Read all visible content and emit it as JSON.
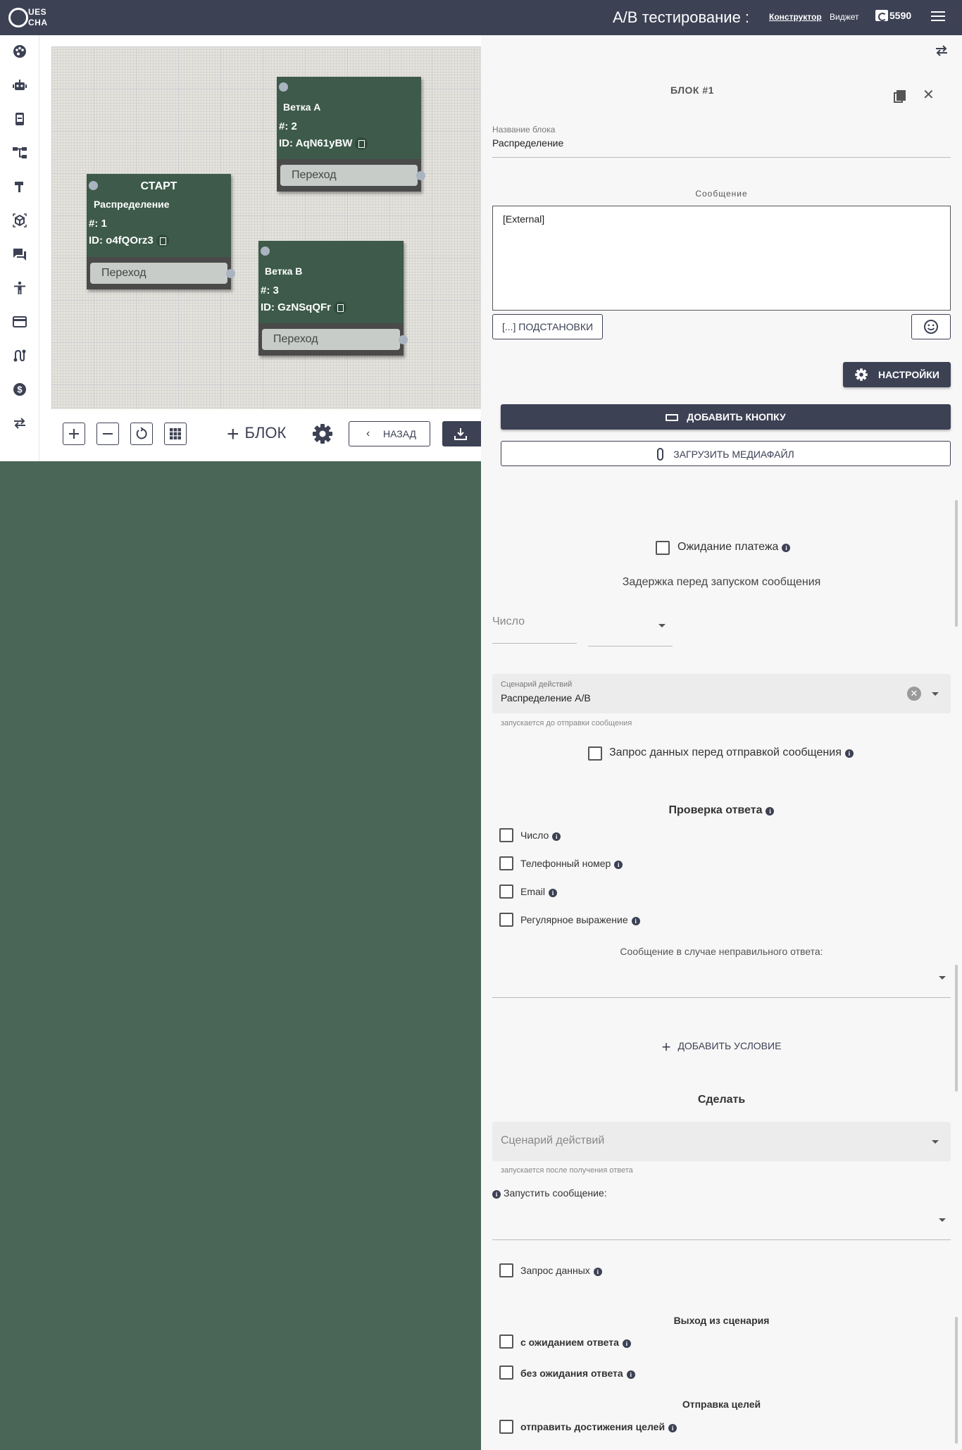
{
  "header": {
    "logo_top": "UES",
    "logo_bottom": "CHA",
    "title": "A/B тестирование :",
    "tab_constructor": "Конструктор",
    "tab_widget": "Виджет",
    "balance": "5590"
  },
  "sidebar": {
    "icons": [
      "palette-icon",
      "robot-icon",
      "phone-icon",
      "flow-tree-icon",
      "hammer-icon",
      "cube-icon",
      "chat-icon",
      "accessibility-icon",
      "credit-card-icon",
      "route-icon",
      "dollar-icon",
      "swap-icon"
    ]
  },
  "canvas": {
    "nodes": {
      "start": {
        "title": "СТАРТ",
        "name": "Распределение",
        "num": "#: 1",
        "id": "ID: o4fQOrz3",
        "transition": "Переход"
      },
      "branch_a": {
        "name": "Ветка А",
        "num": "#: 2",
        "id": "ID: AqN61yBW",
        "transition": "Переход"
      },
      "branch_b": {
        "name": "Ветка В",
        "num": "#: 3",
        "id": "ID: GzNSqQFr",
        "transition": "Переход"
      }
    },
    "toolbar": {
      "add_block": "БЛОК",
      "back": "НАЗАД"
    }
  },
  "panel": {
    "block_title": "БЛОК #1",
    "block_name_label": "Название блока",
    "block_name_value": "Распределение",
    "message_caption": "Сообщение",
    "message_value": "[External]",
    "substitutions_btn": "[...] ПОДСТАНОВКИ",
    "settings_btn": "НАСТРОЙКИ",
    "add_button_btn": "ДОБАВИТЬ КНОПКУ",
    "upload_media_btn": "ЗАГРУЗИТЬ МЕДИАФАЙЛ",
    "payment_wait": "Ожидание платежа",
    "delay_title": "Задержка перед запуском сообщения",
    "delay_number_placeholder": "Число",
    "scenario_label": "Сценарий действий",
    "scenario_value": "Распределение A/B",
    "scenario_hint": "запускается до отправки сообщения",
    "request_before": "Запрос данных перед отправкой сообщения",
    "check_answer_title": "Проверка ответа",
    "check_number": "Число",
    "check_phone": "Телефонный номер",
    "check_email": "Email",
    "check_regex": "Регулярное выражение",
    "wrong_answer_label": "Сообщение в случае неправильного ответа:",
    "add_condition": "ДОБАВИТЬ УСЛОВИЕ",
    "do_title": "Сделать",
    "do_scenario_placeholder": "Сценарий действий",
    "do_scenario_hint": "запускается после получения ответа",
    "run_message_label": "Запустить сообщение:",
    "request_data": "Запрос данных",
    "exit_title": "Выход из сценария",
    "exit_with_wait": "с ожиданием ответа",
    "exit_without_wait": "без ожидания ответа",
    "goals_title": "Отправка целей",
    "send_goals": "отправить достижения целей"
  },
  "colors": {
    "header": "#3c4154",
    "node": "#3d5a4a",
    "background": "#496656"
  }
}
